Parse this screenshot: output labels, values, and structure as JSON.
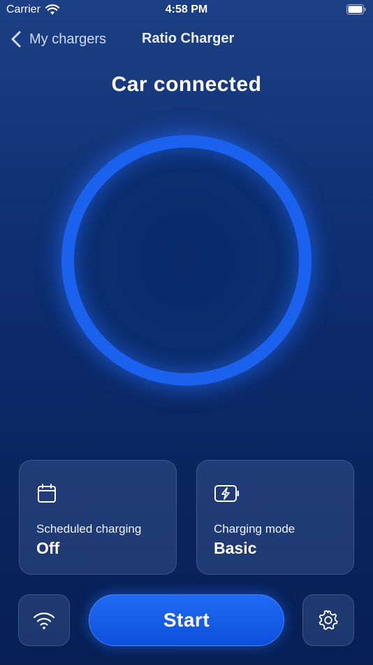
{
  "status_bar": {
    "carrier": "Carrier",
    "time": "4:58 PM"
  },
  "nav": {
    "back_label": "My chargers",
    "title": "Ratio Charger"
  },
  "headline": "Car connected",
  "cards": {
    "scheduled": {
      "label": "Scheduled charging",
      "value": "Off",
      "icon": "calendar-icon"
    },
    "mode": {
      "label": "Charging mode",
      "value": "Basic",
      "icon": "battery-charging-icon"
    }
  },
  "actions": {
    "start_label": "Start",
    "wifi_icon": "wifi-icon",
    "settings_icon": "gear-icon"
  },
  "colors": {
    "accent": "#1a62ee",
    "background": "#0f2f72"
  }
}
